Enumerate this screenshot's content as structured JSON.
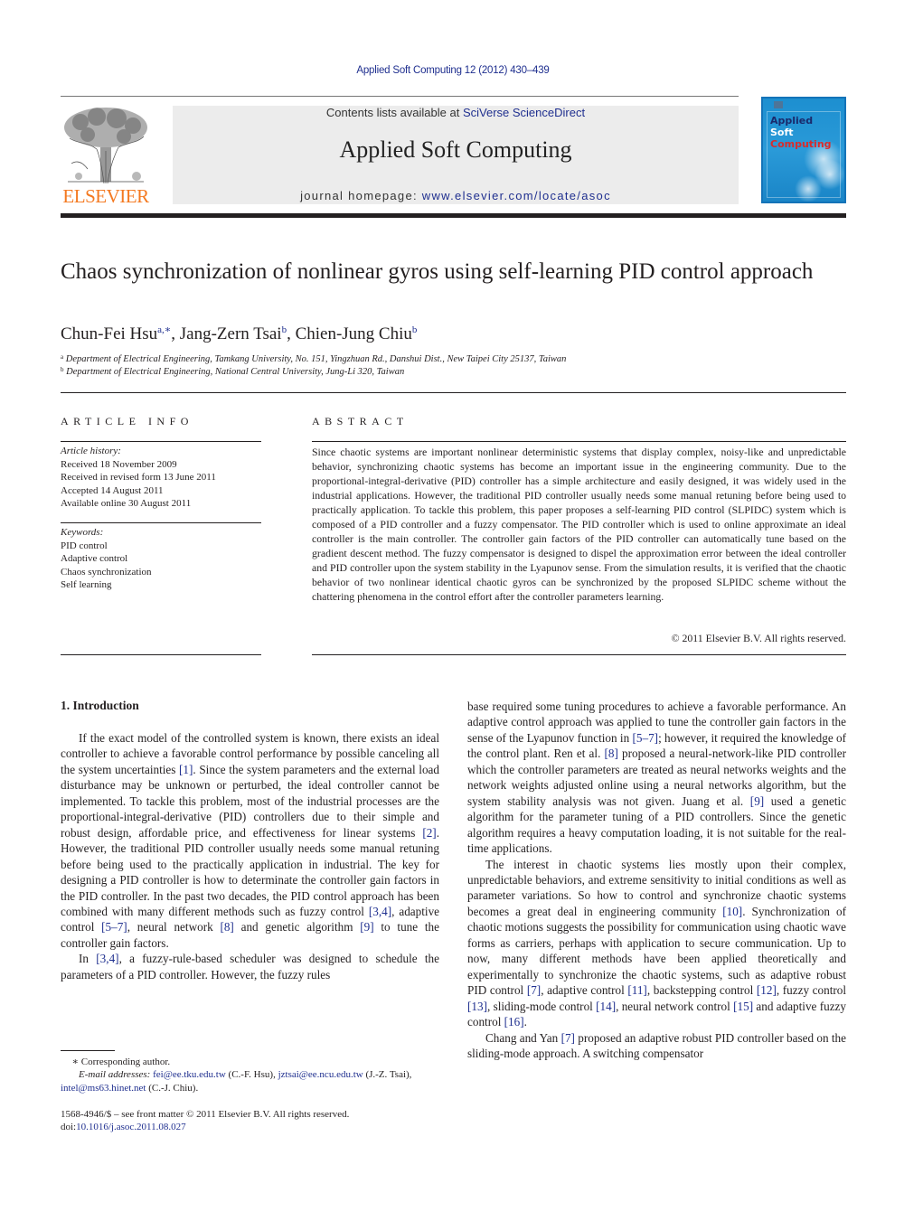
{
  "header": {
    "journal_reference": "Applied Soft Computing 12 (2012) 430–439",
    "contents_prefix": "Contents lists available at ",
    "contents_link": "SciVerse ScienceDirect",
    "journal_title": "Applied Soft Computing",
    "homepage_prefix": "journal homepage: ",
    "homepage_link": "www.elsevier.com/locate/asoc",
    "publisher_logo_text": "ELSEVIER",
    "cover": {
      "line1": "Applied",
      "line2": "Soft",
      "line3": "Computing",
      "colors": {
        "background": "#1d8fd0",
        "line1": "#1a2a6c",
        "line2": "#ffffff",
        "line3": "#d92b2b"
      }
    }
  },
  "colors": {
    "link": "#1f2f8f",
    "publisher_orange": "#f47920",
    "banner_bg": "#ececec",
    "text": "#231f20"
  },
  "article": {
    "title": "Chaos synchronization of nonlinear gyros using self-learning PID control approach",
    "authors": [
      {
        "name": "Chun-Fei Hsu",
        "sup": "a,∗"
      },
      {
        "name": "Jang-Zern Tsai",
        "sup": "b"
      },
      {
        "name": "Chien-Jung Chiu",
        "sup": "b"
      }
    ],
    "affiliations": [
      {
        "mark": "a",
        "text": "Department of Electrical Engineering, Tamkang University, No. 151, Yingzhuan Rd., Danshui Dist., New Taipei City 25137, Taiwan"
      },
      {
        "mark": "b",
        "text": "Department of Electrical Engineering, National Central University, Jung-Li 320, Taiwan"
      }
    ]
  },
  "article_info": {
    "heading": "ARTICLE INFO",
    "history_label": "Article history:",
    "history": [
      "Received 18 November 2009",
      "Received in revised form 13 June 2011",
      "Accepted 14 August 2011",
      "Available online 30 August 2011"
    ],
    "keywords_label": "Keywords:",
    "keywords": [
      "PID control",
      "Adaptive control",
      "Chaos synchronization",
      "Self learning"
    ]
  },
  "abstract": {
    "heading": "ABSTRACT",
    "text": "Since chaotic systems are important nonlinear deterministic systems that display complex, noisy-like and unpredictable behavior, synchronizing chaotic systems has become an important issue in the engineering community. Due to the proportional-integral-derivative (PID) controller has a simple architecture and easily designed, it was widely used in the industrial applications. However, the traditional PID controller usually needs some manual retuning before being used to practically application. To tackle this problem, this paper proposes a self-learning PID control (SLPIDC) system which is composed of a PID controller and a fuzzy compensator. The PID controller which is used to online approximate an ideal controller is the main controller. The controller gain factors of the PID controller can automatically tune based on the gradient descent method. The fuzzy compensator is designed to dispel the approximation error between the ideal controller and PID controller upon the system stability in the Lyapunov sense. From the simulation results, it is verified that the chaotic behavior of two nonlinear identical chaotic gyros can be synchronized by the proposed SLPIDC scheme without the chattering phenomena in the control effort after the controller parameters learning.",
    "copyright": "© 2011 Elsevier B.V. All rights reserved."
  },
  "introduction": {
    "heading": "1.  Introduction",
    "left_column": [
      {
        "indent": true,
        "segments": [
          {
            "t": "If the exact model of the controlled system is known, there exists an ideal controller to achieve a favorable control performance by possible canceling all the system uncertainties "
          },
          {
            "t": "[1]",
            "ref": true
          },
          {
            "t": ". Since the system parameters and the external load disturbance may be unknown or perturbed, the ideal controller cannot be implemented. To tackle this problem, most of the industrial processes are the proportional-integral-derivative (PID) controllers due to their simple and robust design, affordable price, and effectiveness for linear systems "
          },
          {
            "t": "[2]",
            "ref": true
          },
          {
            "t": ". However, the traditional PID controller usually needs some manual retuning before being used to the practically application in industrial. The key for designing a PID controller is how to determinate the controller gain factors in the PID controller. In the past two decades, the PID control approach has been combined with many different methods such as fuzzy control "
          },
          {
            "t": "[3,4]",
            "ref": true
          },
          {
            "t": ", adaptive control "
          },
          {
            "t": "[5–7]",
            "ref": true
          },
          {
            "t": ", neural network "
          },
          {
            "t": "[8]",
            "ref": true
          },
          {
            "t": " and genetic algorithm "
          },
          {
            "t": "[9]",
            "ref": true
          },
          {
            "t": " to tune the controller gain factors."
          }
        ]
      },
      {
        "indent": true,
        "segments": [
          {
            "t": "In "
          },
          {
            "t": "[3,4]",
            "ref": true
          },
          {
            "t": ", a fuzzy-rule-based scheduler was designed to schedule the parameters of a PID controller. However, the fuzzy rules"
          }
        ]
      }
    ],
    "right_column": [
      {
        "indent": false,
        "segments": [
          {
            "t": "base required some tuning procedures to achieve a favorable performance. An adaptive control approach was applied to tune the controller gain factors in the sense of the Lyapunov function in "
          },
          {
            "t": "[5–7]",
            "ref": true
          },
          {
            "t": "; however, it required the knowledge of the control plant. Ren et al. "
          },
          {
            "t": "[8]",
            "ref": true
          },
          {
            "t": " proposed a neural-network-like PID controller which the controller parameters are treated as neural networks weights and the network weights adjusted online using a neural networks algorithm, but the system stability analysis was not given. Juang et al. "
          },
          {
            "t": "[9]",
            "ref": true
          },
          {
            "t": " used a genetic algorithm for the parameter tuning of a PID controllers. Since the genetic algorithm requires a heavy computation loading, it is not suitable for the real-time applications."
          }
        ]
      },
      {
        "indent": true,
        "segments": [
          {
            "t": "The interest in chaotic systems lies mostly upon their complex, unpredictable behaviors, and extreme sensitivity to initial conditions as well as parameter variations. So how to control and synchronize chaotic systems becomes a great deal in engineering community "
          },
          {
            "t": "[10]",
            "ref": true
          },
          {
            "t": ". Synchronization of chaotic motions suggests the possibility for communication using chaotic wave forms as carriers, perhaps with application to secure communication. Up to now, many different methods have been applied theoretically and experimentally to synchronize the chaotic systems, such as adaptive robust PID control "
          },
          {
            "t": "[7]",
            "ref": true
          },
          {
            "t": ", adaptive control "
          },
          {
            "t": "[11]",
            "ref": true
          },
          {
            "t": ", backstepping control "
          },
          {
            "t": "[12]",
            "ref": true
          },
          {
            "t": ", fuzzy control "
          },
          {
            "t": "[13]",
            "ref": true
          },
          {
            "t": ", sliding-mode control "
          },
          {
            "t": "[14]",
            "ref": true
          },
          {
            "t": ", neural network control "
          },
          {
            "t": "[15]",
            "ref": true
          },
          {
            "t": " and adaptive fuzzy control "
          },
          {
            "t": "[16]",
            "ref": true
          },
          {
            "t": "."
          }
        ]
      },
      {
        "indent": true,
        "segments": [
          {
            "t": "Chang and Yan "
          },
          {
            "t": "[7]",
            "ref": true
          },
          {
            "t": " proposed an adaptive robust PID controller based on the sliding-mode approach. A switching compensator"
          }
        ]
      }
    ]
  },
  "footnotes": {
    "corresponding_mark": "∗",
    "corresponding_text": "Corresponding author.",
    "email_label": "E-mail addresses:",
    "emails": [
      {
        "address": "fei@ee.tku.edu.tw",
        "owner": " (C.-F. Hsu), "
      },
      {
        "address": "jztsai@ee.ncu.edu.tw",
        "owner": " (J.-Z. Tsai),"
      },
      {
        "address": "intel@ms63.hinet.net",
        "owner": " (C.-J. Chiu)."
      }
    ],
    "front_matter": "1568-4946/$ – see front matter © 2011 Elsevier B.V. All rights reserved.",
    "doi_prefix": "doi:",
    "doi": "10.1016/j.asoc.2011.08.027"
  }
}
